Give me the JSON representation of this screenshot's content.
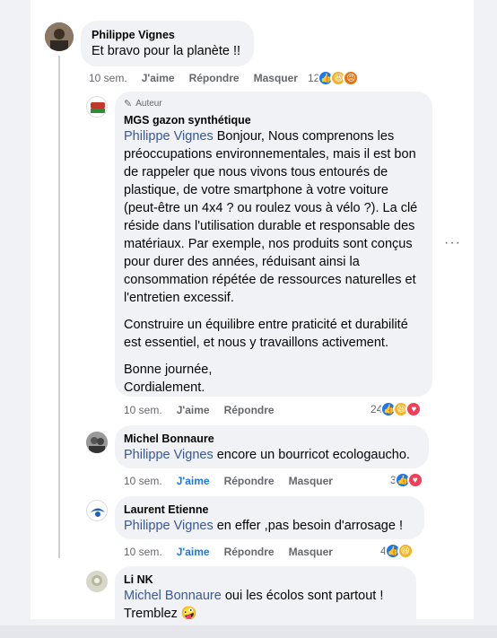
{
  "comments": [
    {
      "author": "Philippe Vignes",
      "text": "Et bravo pour la planète !!",
      "time": "10 sem.",
      "like": "J'aime",
      "reply": "Répondre",
      "hide": "Masquer",
      "reactions_count": "12",
      "reactions": [
        "like",
        "haha",
        "angry"
      ]
    },
    {
      "badge": "Auteur",
      "author": "MGS gazon synthétique",
      "mention": "Philippe Vignes",
      "para1": " Bonjour, Nous comprenons les préoccupations environnementales, mais il est bon de rappeler que nous vivons tous entourés de plastique, de votre smartphone à votre voiture (peut-être un 4x4 ? ou roulez vous à vélo ?). La clé réside dans l'utilisation durable et responsable des matériaux. Par exemple, nos produits sont conçus pour durer des années, réduisant ainsi la consommation répétée de ressources naturelles et l'entretien excessif.",
      "para2": "Construire un équilibre entre praticité et durabilité est essentiel, et nous y travaillons activement.",
      "para3a": "Bonne journée,",
      "para3b": "Cordialement.",
      "time": "10 sem.",
      "like": "J'aime",
      "reply": "Répondre",
      "reactions_count": "24",
      "reactions": [
        "like",
        "haha",
        "love"
      ]
    },
    {
      "author": "Michel Bonnaure",
      "mention": "Philippe Vignes",
      "text": " encore un bourricot ecologaucho.",
      "time": "10 sem.",
      "like": "J'aime",
      "reply": "Répondre",
      "hide": "Masquer",
      "reactions_count": "3",
      "reactions": [
        "like",
        "love"
      ]
    },
    {
      "author": "Laurent Etienne",
      "mention": "Philippe Vignes",
      "text": " en effer ,pas besoin d'arrosage !",
      "time": "10 sem.",
      "like": "J'aime",
      "reply": "Répondre",
      "hide": "Masquer",
      "reactions_count": "4",
      "reactions": [
        "like",
        "haha"
      ]
    },
    {
      "author": "Li NK",
      "mention": "Michel Bonnaure",
      "text": " oui les écolos sont partout !",
      "text2": "Tremblez 🤪"
    }
  ],
  "more_icon": "···",
  "colors": {
    "like_blue": "#1877f2",
    "mention_blue": "#385898",
    "meta_grey": "#65676b",
    "bubble_bg": "#f0f2f5"
  }
}
